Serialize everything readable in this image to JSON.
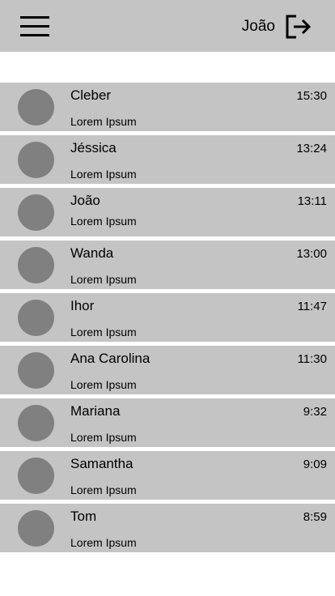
{
  "header": {
    "user_name": "João",
    "menu_icon": "hamburger-menu-icon",
    "logout_icon": "logout-icon"
  },
  "chats": [
    {
      "name": "Cleber",
      "message": "Lorem Ipsum",
      "time": "15:30"
    },
    {
      "name": "Jéssica",
      "message": "Lorem Ipsum",
      "time": "13:24"
    },
    {
      "name": "João",
      "message": "Lorem Ipsum",
      "time": "13:11"
    },
    {
      "name": "Wanda",
      "message": "Lorem Ipsum",
      "time": "13:00"
    },
    {
      "name": "Ihor",
      "message": "Lorem Ipsum",
      "time": "11:47"
    },
    {
      "name": "Ana Carolina",
      "message": "Lorem Ipsum",
      "time": "11:30"
    },
    {
      "name": "Mariana",
      "message": "Lorem Ipsum",
      "time": "9:32"
    },
    {
      "name": "Samantha",
      "message": "Lorem Ipsum",
      "time": "9:09"
    },
    {
      "name": "Tom",
      "message": "Lorem Ipsum",
      "time": "8:59"
    }
  ],
  "colors": {
    "bar_background": "#c4c4c4",
    "avatar": "#808080",
    "page_background": "#ffffff"
  }
}
